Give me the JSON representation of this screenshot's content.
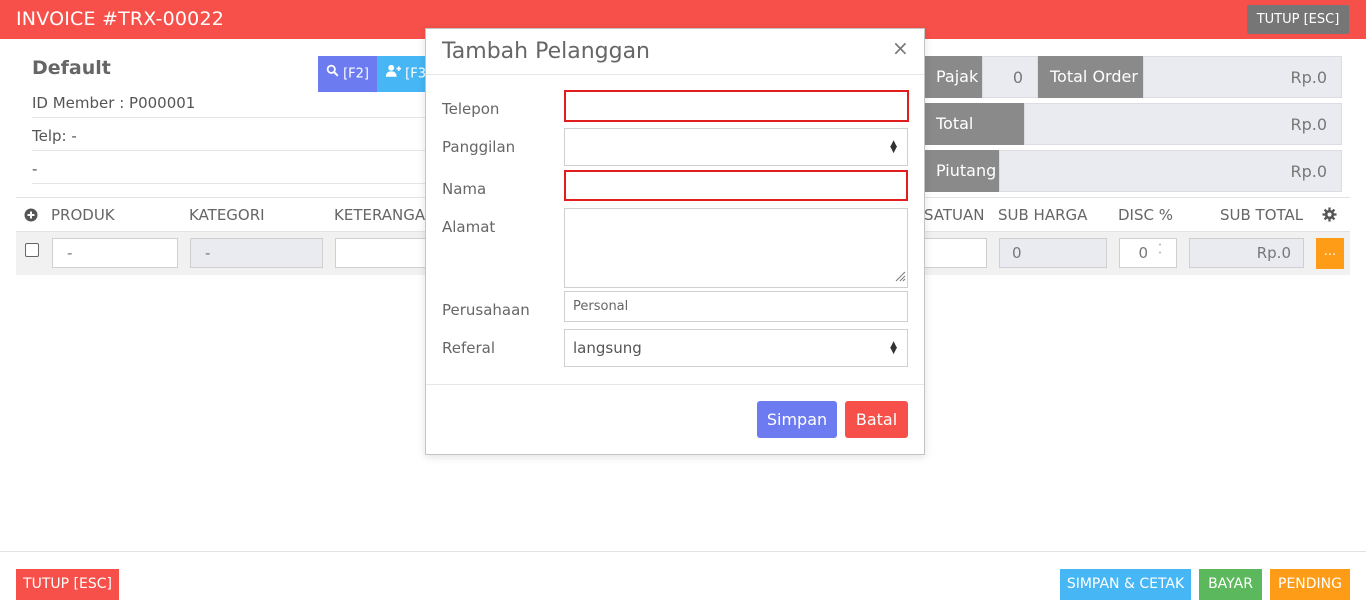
{
  "header": {
    "title": "INVOICE #TRX-00022",
    "close_label": "TUTUP [ESC]"
  },
  "customer": {
    "name": "Default",
    "member_id": "ID Member : P000001",
    "phone": "Telp: -",
    "address": "-",
    "search_button": "[F2]",
    "add_button": "[F3"
  },
  "totals": {
    "tax_label": "Pajak",
    "tax_value": "0",
    "total_order_label": "Total Order",
    "total_order_value": "Rp.0",
    "total_paid_label": "Total Bayar",
    "total_paid_value": "Rp.0",
    "receivable_label": "Piutang",
    "receivable_value": "Rp.0"
  },
  "table": {
    "headers": [
      "PRODUK",
      "KATEGORI",
      "KETERANGA",
      "SATUAN",
      "SUB HARGA",
      "DISC %",
      "SUB TOTAL"
    ],
    "row": {
      "product": "-",
      "category": "-",
      "note": "",
      "unit": "",
      "sub_price": "0",
      "discount": "0",
      "sub_total": "Rp.0",
      "more": "..."
    }
  },
  "footer": {
    "close_label": "TUTUP [ESC]",
    "save_print_label": "SIMPAN & CETAK",
    "pay_label": "BAYAR",
    "pending_label": "PENDING"
  },
  "modal": {
    "title": "Tambah Pelanggan",
    "close": "×",
    "fields": {
      "phone_label": "Telepon",
      "phone_value": "",
      "salutation_label": "Panggilan",
      "salutation_value": "",
      "name_label": "Nama",
      "name_value": "",
      "address_label": "Alamat",
      "address_value": "",
      "company_label": "Perusahaan",
      "company_placeholder": "Personal",
      "referral_label": "Referal",
      "referral_value": "langsung"
    },
    "save_label": "Simpan",
    "cancel_label": "Batal"
  },
  "colors": {
    "header": "#f7504a",
    "primary": "#6d7bf1",
    "info": "#46b6f5",
    "danger": "#f7504a",
    "success": "#5cb85c",
    "warning": "#ff9c17",
    "grey": "#8a8a8a"
  }
}
